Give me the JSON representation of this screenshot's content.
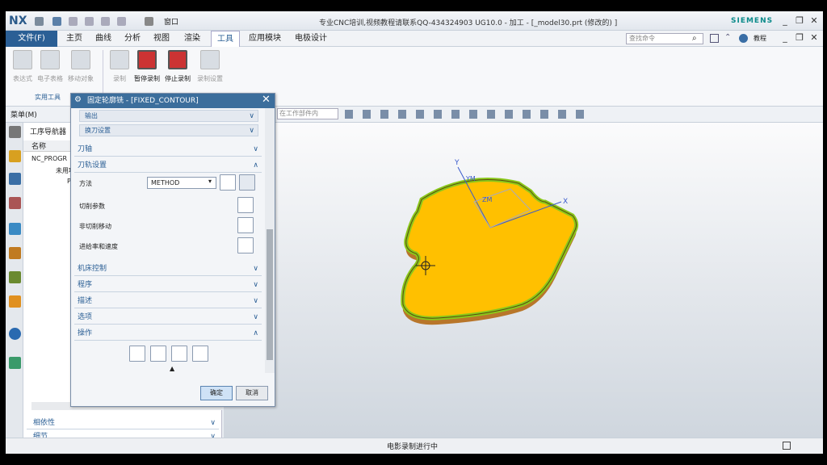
{
  "window": {
    "logo": "NX",
    "title": "专业CNC培训,视频教程请联系QQ-434324903 UG10.0 - 加工 - [_model30.prt  (修改的) ]",
    "brand": "SIEMENS",
    "window_menu": "窗口"
  },
  "menubar": {
    "file": "文件(F)",
    "tabs": [
      "主页",
      "曲线",
      "分析",
      "视图",
      "渲染",
      "工具",
      "应用模块",
      "电极设计"
    ],
    "search_placeholder": "查找命令",
    "tutorial": "教程"
  },
  "ribbon": {
    "buttons": [
      "表达式",
      "电子表格",
      "移动对象",
      "录制",
      "暂停录制",
      "停止录制",
      "录制设置"
    ],
    "group_label": "实用工具"
  },
  "toolbar2": {
    "menu": "菜单(M)",
    "filter": "在工作部件内"
  },
  "navigator": {
    "title": "工序导航器",
    "column": "名称",
    "rows": [
      "NC_PROGR",
      "未用项",
      "PR"
    ]
  },
  "nav_sections": [
    "相依性",
    "细节"
  ],
  "dialog": {
    "title": "固定轮廓铣 - [FIXED_CONTOUR]",
    "sub1": "输出",
    "sub2": "换刀设置",
    "sections": {
      "tool_axis": "刀轴",
      "tool_path": "刀轨设置",
      "machine": "机床控制",
      "program": "程序",
      "desc": "描述",
      "options": "选项",
      "actions": "操作"
    },
    "method_label": "方法",
    "method_value": "METHOD",
    "cut_params": "切削参数",
    "non_cut": "非切削移动",
    "feeds": "进给率和速度",
    "ok": "确定",
    "cancel": "取消"
  },
  "status": {
    "text": "电影录制进行中"
  },
  "axis_labels": {
    "y": "Y",
    "ym": "YM",
    "zm": "ZM",
    "x": "X"
  }
}
